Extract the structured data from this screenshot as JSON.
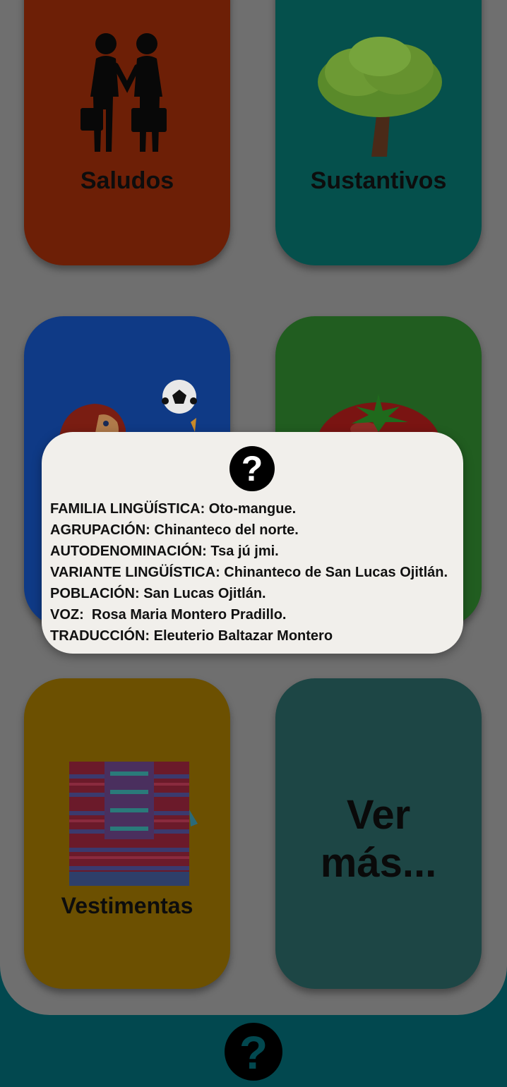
{
  "cards": {
    "saludos": {
      "label": "Saludos",
      "icon": "handshake-icon"
    },
    "sustantivos": {
      "label": "Sustantivos",
      "icon": "tree-icon"
    },
    "deportes": {
      "label": "",
      "icon": "soccer-boy-icon"
    },
    "frutas": {
      "label": "",
      "icon": "tomato-icon"
    },
    "vestimentas": {
      "label": "Vestimentas",
      "icon": "huipil-icon"
    },
    "ver_mas": {
      "line1": "Ver",
      "line2": "más..."
    }
  },
  "info_dialog": {
    "icon": "question-icon",
    "icon_glyph": "?",
    "lines": [
      "FAMILIA LINGÜÍSTICA: Oto-mangue.",
      "AGRUPACIÓN: Chinanteco del norte.",
      "AUTODENOMINACIÓN: Tsa jú jmi.",
      "VARIANTE LINGÜÍSTICA: Chinanteco de San Lucas Ojitlán.",
      "POBLACIÓN: San Lucas Ojitlán.",
      "VOZ:  Rosa Maria Montero Pradillo.",
      "TRADUCCIÓN: Eleuterio Baltazar Montero"
    ]
  },
  "bottom_bar": {
    "help_glyph": "?",
    "icon": "help-icon"
  },
  "colors": {
    "overlay_panel": "#6f6f6f",
    "bottom_bar": "#02484f",
    "saludos": "#6d1f06",
    "sustantivos": "#05504c",
    "deportes": "#0f3a86",
    "frutas": "#215d20",
    "vestimentas": "#6c5001",
    "ver_mas": "#1d4645",
    "dialog_bg": "#f1efeb"
  }
}
